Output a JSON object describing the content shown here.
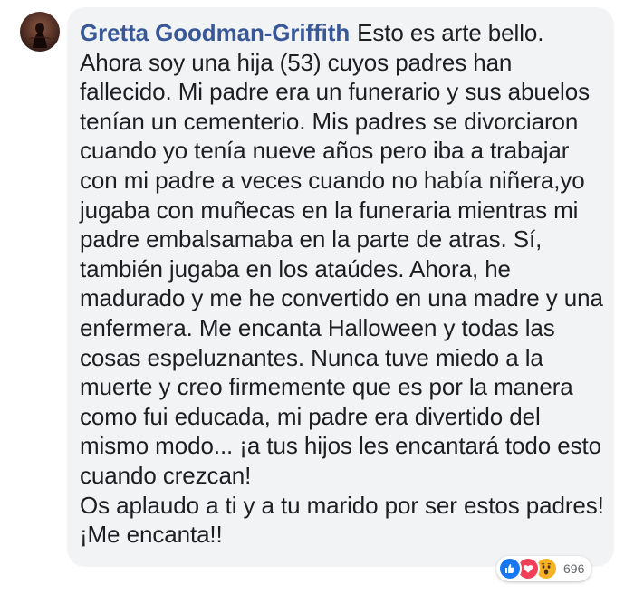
{
  "comment": {
    "author": "Gretta Goodman-Griffith",
    "text": "Esto es arte bello. Ahora soy una hija (53) cuyos padres han fallecido. Mi padre era un funerario y sus abuelos tenían un cementerio. Mis padres se divorciaron cuando yo tenía nueve años pero iba a trabajar con mi padre a veces cuando no había niñera,yo jugaba con muñecas en la funeraria mientras mi padre embalsamaba en la parte de atras. Sí, también jugaba en los ataúdes. Ahora, he madurado y me he convertido en una madre y una enfermera. Me encanta Halloween y todas las cosas espeluznantes. Nunca tuve miedo a la muerte y creo firmemente que es por la manera como fui educada, mi padre era divertido del mismo modo... ¡a tus hijos les encantará todo esto cuando crezcan!",
    "text_second_paragraph": "Os aplaudo a ti y a tu marido por ser estos padres! ¡Me encanta!!"
  },
  "reactions": {
    "icons": [
      "like-icon",
      "love-icon",
      "wow-icon"
    ],
    "count": "696"
  },
  "colors": {
    "author": "#385898",
    "bubble": "#f2f3f5",
    "like": "#1877f2",
    "love": "#f33e58",
    "wow": "#f7b125"
  }
}
